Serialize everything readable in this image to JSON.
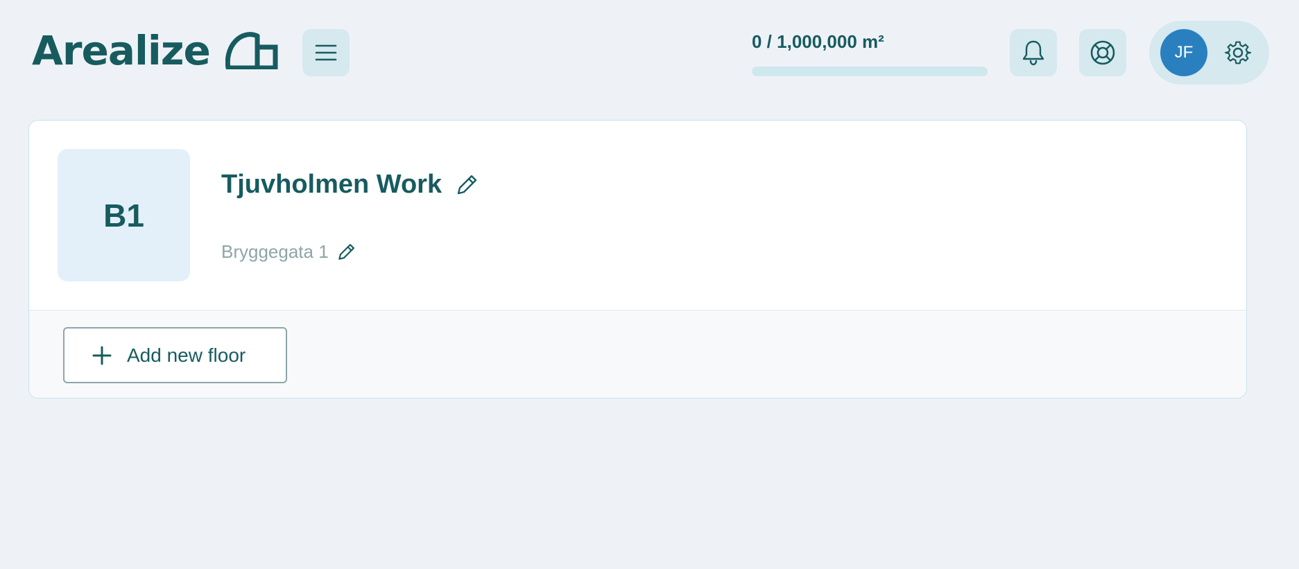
{
  "header": {
    "logo_text": "Arealize",
    "logo_icon": "building-mark-icon",
    "menu_icon": "hamburger-menu-icon",
    "usage": {
      "text": "0 / 1,000,000 m²",
      "used": 0,
      "limit": 1000000,
      "fraction": 0
    },
    "notifications_icon": "bell-icon",
    "help_icon": "lifebuoy-icon",
    "user": {
      "initials": "JF"
    },
    "settings_icon": "gear-icon"
  },
  "building": {
    "badge": "B1",
    "name": "Tjuvholmen Work",
    "address": "Bryggegata 1",
    "edit_icon": "pencil-icon"
  },
  "actions": {
    "add_floor_label": "Add new floor",
    "add_floor_icon": "plus-icon"
  },
  "colors": {
    "background": "#eef2f7",
    "primary_text": "#175b5f",
    "button_tint": "#d5e9ef",
    "avatar": "#2a80bf",
    "badge": "#e3f0f9",
    "muted_text": "#8ea5a8"
  }
}
